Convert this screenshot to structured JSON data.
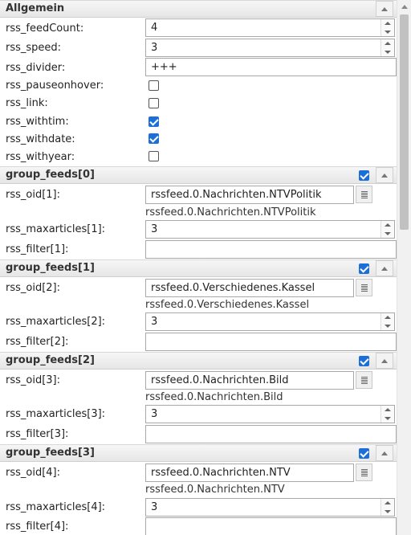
{
  "general": {
    "title": "Allgemein",
    "feedCount": {
      "label": "rss_feedCount:",
      "value": "4"
    },
    "speed": {
      "label": "rss_speed:",
      "value": "3"
    },
    "divider": {
      "label": "rss_divider:",
      "value": "+++"
    },
    "pauseonhover": {
      "label": "rss_pauseonhover:",
      "checked": false
    },
    "link": {
      "label": "rss_link:",
      "checked": false
    },
    "withtime": {
      "label": "rss_withtim:",
      "checked": true
    },
    "withdate": {
      "label": "rss_withdate:",
      "checked": true
    },
    "withyear": {
      "label": "rss_withyear:",
      "checked": false
    }
  },
  "groups": [
    {
      "title": "group_feeds[0]",
      "enabled": true,
      "oid_label": "rss_oid[1]:",
      "oid_value": "rssfeed.0.Nachrichten.NTVPolitik",
      "oid_name": "rssfeed.0.Nachrichten.NTVPolitik",
      "maxarticles_label": "rss_maxarticles[1]:",
      "maxarticles_value": "3",
      "filter_label": "rss_filter[1]:",
      "filter_value": ""
    },
    {
      "title": "group_feeds[1]",
      "enabled": true,
      "oid_label": "rss_oid[2]:",
      "oid_value": "rssfeed.0.Verschiedenes.Kassel",
      "oid_name": "rssfeed.0.Verschiedenes.Kassel",
      "maxarticles_label": "rss_maxarticles[2]:",
      "maxarticles_value": "3",
      "filter_label": "rss_filter[2]:",
      "filter_value": ""
    },
    {
      "title": "group_feeds[2]",
      "enabled": true,
      "oid_label": "rss_oid[3]:",
      "oid_value": "rssfeed.0.Nachrichten.Bild",
      "oid_name": "rssfeed.0.Nachrichten.Bild",
      "maxarticles_label": "rss_maxarticles[3]:",
      "maxarticles_value": "3",
      "filter_label": "rss_filter[3]:",
      "filter_value": ""
    },
    {
      "title": "group_feeds[3]",
      "enabled": true,
      "oid_label": "rss_oid[4]:",
      "oid_value": "rssfeed.0.Nachrichten.NTV",
      "oid_name": "rssfeed.0.Nachrichten.NTV",
      "maxarticles_label": "rss_maxarticles[4]:",
      "maxarticles_value": "3",
      "filter_label": "rss_filter[4]:",
      "filter_value": ""
    }
  ],
  "colors": {
    "accent": "#1d6fd8",
    "header_bg": "#ececec"
  },
  "icons": {
    "collapse": "chevron-up-icon",
    "select_oid": "list-icon"
  }
}
